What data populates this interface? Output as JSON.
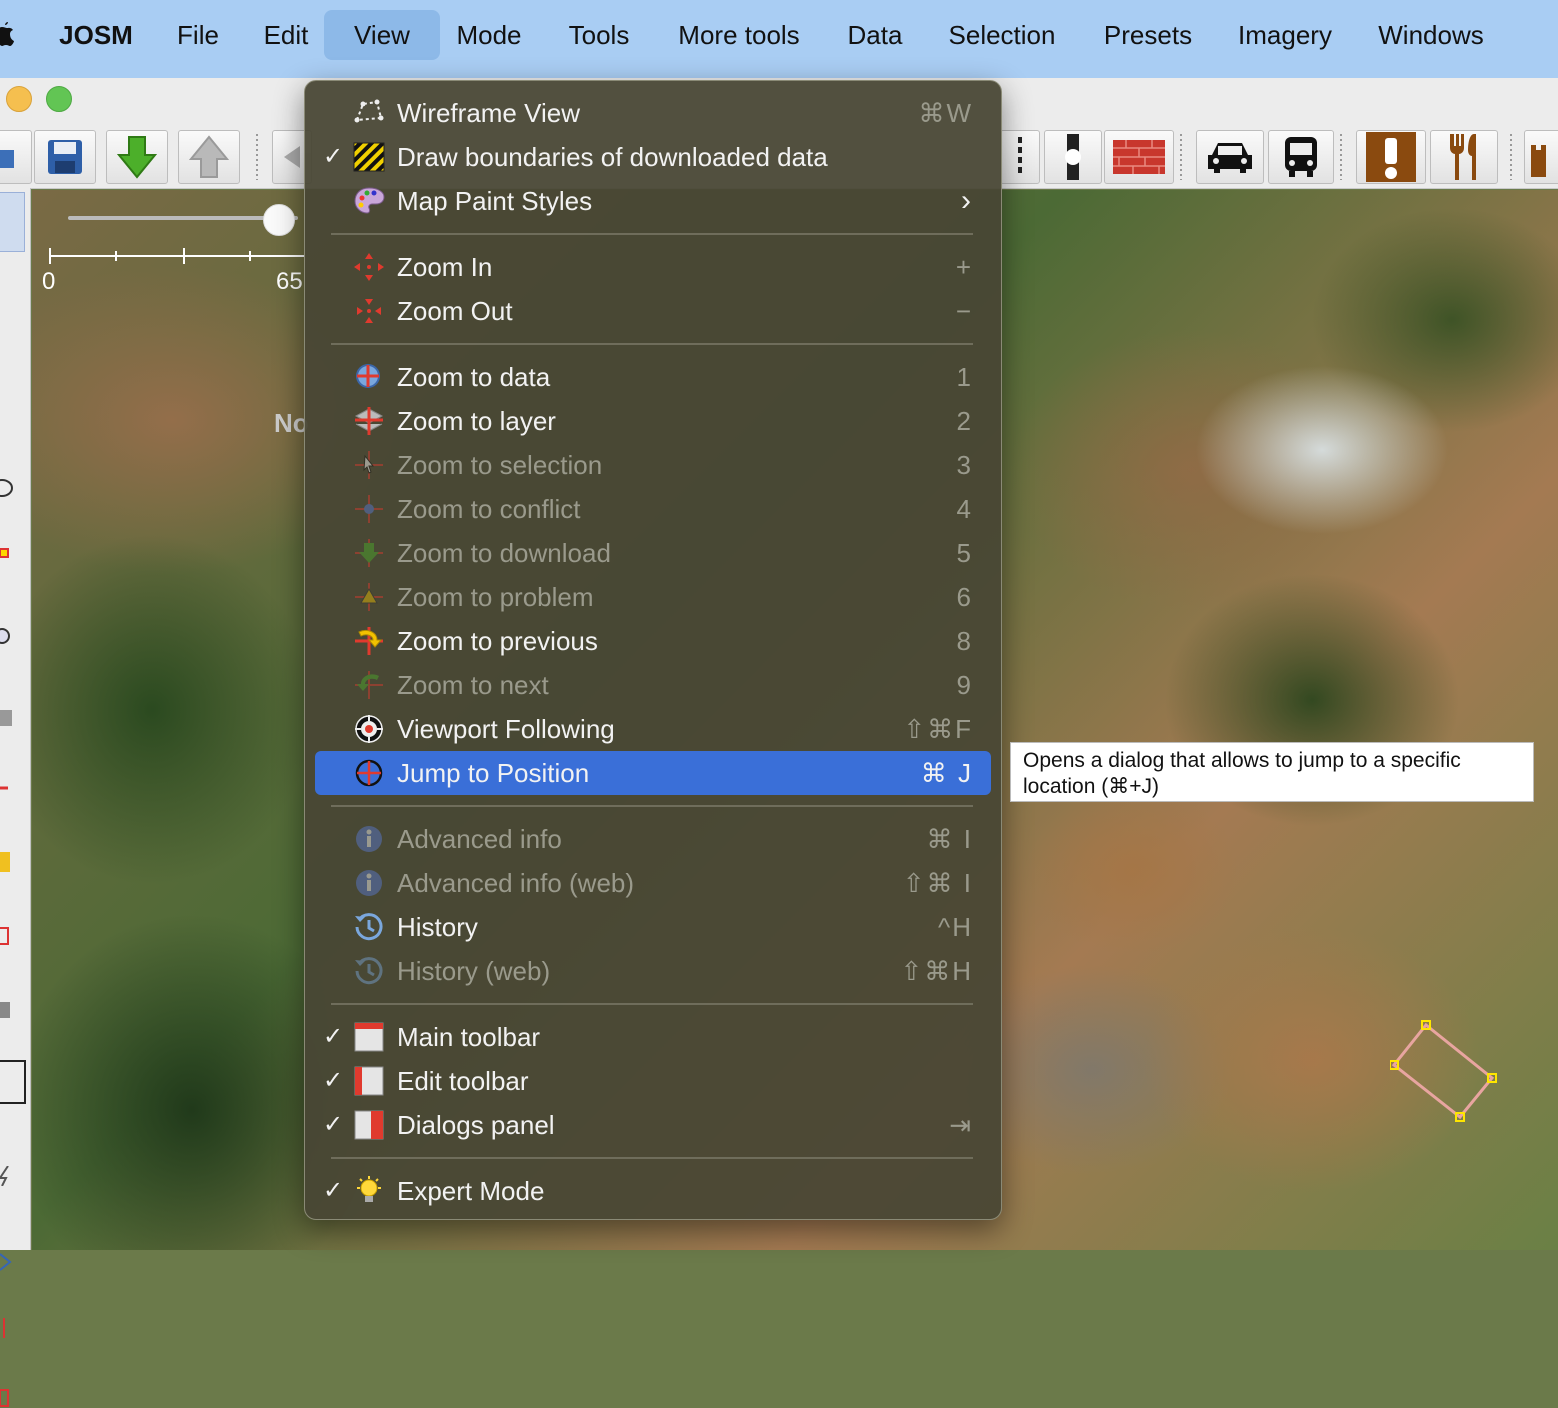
{
  "menubar": {
    "app": "JOSM",
    "items": [
      "File",
      "Edit",
      "View",
      "Mode",
      "Tools",
      "More tools",
      "Data",
      "Selection",
      "Presets",
      "Imagery",
      "Windows"
    ]
  },
  "map": {
    "scale_start": "0",
    "scale_mid": "65",
    "label_fragment": "No"
  },
  "view_menu": {
    "items": [
      {
        "label": "Wireframe View",
        "shortcut": "⌘W",
        "icon": "wireframe-icon"
      },
      {
        "label": "Draw boundaries of downloaded data",
        "shortcut": "",
        "checked": true,
        "icon": "hatched-boundary-icon"
      },
      {
        "label": "Map Paint Styles",
        "shortcut": "›",
        "icon": "palette-icon"
      },
      {
        "label": "Zoom In",
        "shortcut": "+",
        "icon": "zoom-in-icon"
      },
      {
        "label": "Zoom Out",
        "shortcut": "−",
        "icon": "zoom-out-icon"
      },
      {
        "label": "Zoom to data",
        "shortcut": "1",
        "icon": "zoom-data-icon"
      },
      {
        "label": "Zoom to layer",
        "shortcut": "2",
        "icon": "zoom-layer-icon"
      },
      {
        "label": "Zoom to selection",
        "shortcut": "3",
        "disabled": true,
        "icon": "zoom-selection-icon"
      },
      {
        "label": "Zoom to conflict",
        "shortcut": "4",
        "disabled": true,
        "icon": "zoom-conflict-icon"
      },
      {
        "label": "Zoom to download",
        "shortcut": "5",
        "disabled": true,
        "icon": "zoom-download-icon"
      },
      {
        "label": "Zoom to problem",
        "shortcut": "6",
        "disabled": true,
        "icon": "zoom-problem-icon"
      },
      {
        "label": "Zoom to previous",
        "shortcut": "8",
        "icon": "zoom-previous-icon"
      },
      {
        "label": "Zoom to next",
        "shortcut": "9",
        "disabled": true,
        "icon": "zoom-next-icon"
      },
      {
        "label": "Viewport Following",
        "shortcut": "⇧⌘F",
        "icon": "viewport-following-icon"
      },
      {
        "label": "Jump to Position",
        "shortcut": "⌘ J",
        "selected": true,
        "icon": "jump-to-position-icon"
      },
      {
        "label": "Advanced info",
        "shortcut": "⌘ I",
        "disabled": true,
        "icon": "info-icon"
      },
      {
        "label": "Advanced info (web)",
        "shortcut": "⇧⌘ I",
        "disabled": true,
        "icon": "info-web-icon"
      },
      {
        "label": "History",
        "shortcut": "^H",
        "icon": "history-icon"
      },
      {
        "label": "History (web)",
        "shortcut": "⇧⌘H",
        "disabled": true,
        "icon": "history-web-icon"
      },
      {
        "label": "Main toolbar",
        "shortcut": "",
        "checked": true,
        "icon": "main-toolbar-icon"
      },
      {
        "label": "Edit toolbar",
        "shortcut": "",
        "checked": true,
        "icon": "edit-toolbar-icon"
      },
      {
        "label": "Dialogs panel",
        "shortcut": "⇥",
        "checked": true,
        "icon": "dialogs-panel-icon"
      },
      {
        "label": "Expert Mode",
        "shortcut": "",
        "checked": true,
        "icon": "lightbulb-icon"
      }
    ]
  },
  "tooltip": {
    "line1": "Opens a dialog that allows to jump to a specific",
    "line2": "location (⌘+J)"
  },
  "colors": {
    "menubar_bg": "#a9cdf3",
    "menu_bg": "#48463a",
    "selection": "#3a6fd8",
    "accent_red": "#e03a2e"
  }
}
